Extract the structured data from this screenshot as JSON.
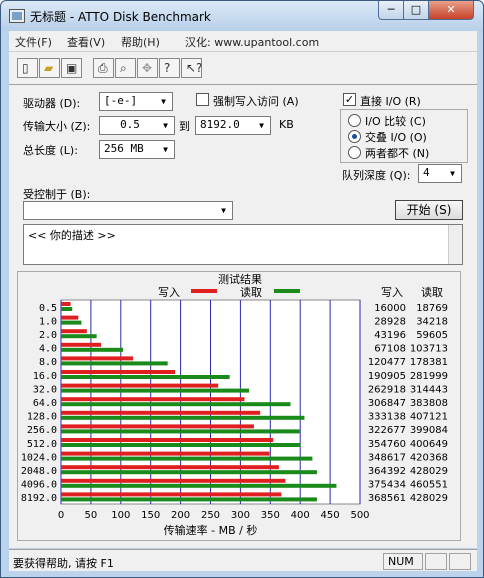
{
  "window": {
    "title": "无标题 - ATTO Disk Benchmark"
  },
  "caption_buttons": {
    "minimize": "─",
    "maximize": "□",
    "close": "✕"
  },
  "menu": [
    {
      "label": "文件(F)"
    },
    {
      "label": "查看(V)"
    },
    {
      "label": "帮助(H)"
    },
    {
      "label": "汉化: www.upantool.com"
    }
  ],
  "toolbar": {
    "icons": [
      "new-icon",
      "open-icon",
      "save-icon",
      "print-icon",
      "print-preview-icon",
      "move-icon",
      "help-icon",
      "context-help-icon"
    ]
  },
  "form": {
    "drive_label": "驱动器 (D):",
    "drive_value": "[-e-]",
    "force_write_label": "强制写入访问 (A)",
    "force_write_checked": false,
    "direct_io_label": "直接 I/O (R)",
    "direct_io_checked": true,
    "transfer_size_label": "传输大小 (Z):",
    "transfer_from": "0.5",
    "to_label": "到",
    "transfer_to": "8192.0",
    "kb_label": "KB",
    "total_length_label": "总长度 (L):",
    "total_length_value": "256 MB",
    "io_options": [
      {
        "label": "I/O 比较 (C)",
        "selected": false
      },
      {
        "label": "交叠 I/O (O)",
        "selected": true
      },
      {
        "label": "两者都不 (N)",
        "selected": false
      }
    ],
    "queue_depth_label": "队列深度 (Q):",
    "queue_depth_value": "4",
    "controlled_by_label": "受控制于 (B):",
    "controlled_by_value": "",
    "start_button": "开始 (S)",
    "description": "<<  你的描述    >>"
  },
  "results": {
    "title": "测试结果",
    "legend_write": "写入",
    "legend_read": "读取",
    "col_write": "写入",
    "col_read": "读取",
    "xlabel": "传输速率 - MB / 秒"
  },
  "status": {
    "help_text": "要获得帮助, 请按 F1",
    "num": "NUM"
  },
  "chart_data": {
    "type": "bar",
    "orientation": "horizontal",
    "title": "测试结果",
    "xlabel": "传输速率 - MB / 秒",
    "xlim": [
      0,
      500
    ],
    "xticks": [
      0,
      50,
      100,
      150,
      200,
      250,
      300,
      350,
      400,
      450,
      500
    ],
    "categories": [
      "0.5",
      "1.0",
      "2.0",
      "4.0",
      "8.0",
      "16.0",
      "32.0",
      "64.0",
      "128.0",
      "256.0",
      "512.0",
      "1024.0",
      "2048.0",
      "4096.0",
      "8192.0"
    ],
    "series": [
      {
        "name": "写入",
        "color": "#e02020",
        "values": [
          16.0,
          28.9,
          43.2,
          67.1,
          120.5,
          190.9,
          262.9,
          306.8,
          333.1,
          322.7,
          354.8,
          348.6,
          364.4,
          375.4,
          368.6
        ]
      },
      {
        "name": "读取",
        "color": "#1a8a1a",
        "values": [
          18.8,
          34.2,
          59.6,
          103.7,
          178.4,
          282.0,
          314.4,
          383.8,
          407.1,
          399.1,
          400.6,
          420.4,
          428.0,
          460.6,
          428.0
        ]
      }
    ],
    "table": {
      "write": [
        "16000",
        "28928",
        "43196",
        "67108",
        "120477",
        "190905",
        "262918",
        "306847",
        "333138",
        "322677",
        "354760",
        "348617",
        "364392",
        "375434",
        "368561"
      ],
      "read": [
        "18769",
        "34218",
        "59605",
        "103713",
        "178381",
        "281999",
        "314443",
        "383808",
        "407121",
        "399084",
        "400649",
        "420368",
        "428029",
        "460551",
        "428029"
      ]
    },
    "grid": true,
    "legend_position": "top"
  }
}
